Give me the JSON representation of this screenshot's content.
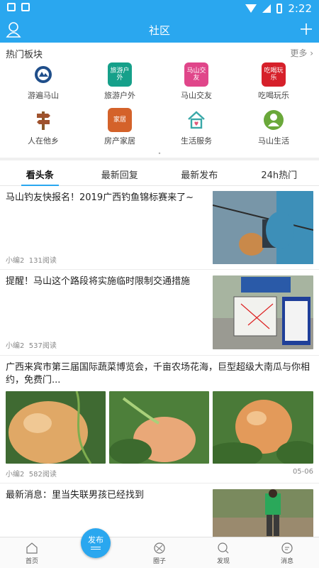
{
  "status_bar": {
    "time": "2:22"
  },
  "header": {
    "title": "社区"
  },
  "hot_section": {
    "title": "热门板块",
    "more_label": "更多",
    "boards": [
      {
        "label": "游遍马山",
        "icon": "travel-seal-icon",
        "color": "#1f4e8a",
        "icon_text": ""
      },
      {
        "label": "旅游户外",
        "icon": "outdoor-icon",
        "color": "#16a08a",
        "icon_text": "旅游户外"
      },
      {
        "label": "马山交友",
        "icon": "friends-icon",
        "color": "#e0468a",
        "icon_text": "马山交友"
      },
      {
        "label": "吃喝玩乐",
        "icon": "food-fun-icon",
        "color": "#d6202a",
        "icon_text": "吃喝玩乐"
      },
      {
        "label": "人在他乡",
        "icon": "signpost-icon",
        "color": "#a0522d",
        "icon_text": ""
      },
      {
        "label": "房产家居",
        "icon": "house-deco-icon",
        "color": "#d4622a",
        "icon_text": "家居"
      },
      {
        "label": "生活服务",
        "icon": "home-service-icon",
        "color": "#3aa8a8",
        "icon_text": ""
      },
      {
        "label": "马山生活",
        "icon": "life-icon",
        "color": "#6aa83a",
        "icon_text": ""
      }
    ]
  },
  "tabs": [
    {
      "label": "看头条",
      "active": true
    },
    {
      "label": "最新回复",
      "active": false
    },
    {
      "label": "最新发布",
      "active": false
    },
    {
      "label": "24h热门",
      "active": false
    }
  ],
  "feed": [
    {
      "title": "马山钓友快报名！2019广西钓鱼锦标赛来了~",
      "author": "小编2",
      "reads": "131阅读",
      "date": ""
    },
    {
      "title": "提醒！马山这个路段将实施临时限制交通措施",
      "author": "小编2",
      "reads": "537阅读",
      "date": ""
    },
    {
      "title": "广西来宾市第三届国际蔬菜博览会，千亩农场花海，巨型超级大南瓜与你相约，免费门...",
      "author": "小编2",
      "reads": "582阅读",
      "date": "05-06"
    },
    {
      "title": "最新消息：里当失联男孩已经找到",
      "author": "",
      "reads": "",
      "date": ""
    }
  ],
  "bottom_nav": {
    "home": "首页",
    "publish": "发布",
    "circle": "圈子",
    "discover": "发现",
    "messages": "消息"
  },
  "colors": {
    "primary": "#2aa7ef"
  }
}
